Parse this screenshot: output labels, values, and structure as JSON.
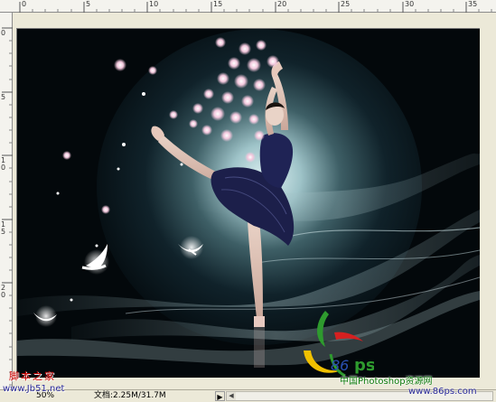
{
  "ruler_top_labels": [
    "0",
    "5",
    "10",
    "15",
    "20",
    "25",
    "30",
    "35"
  ],
  "ruler_left_labels": [
    "0",
    "5",
    "10",
    "15",
    "20"
  ],
  "status": {
    "zoom": "50%",
    "document": "文档:2.25M/31.7M",
    "menu_arrow": "▶"
  },
  "watermarks": {
    "site_cn": "脚本之家",
    "site_url": "www.Jb51.net",
    "logo_number": "86",
    "logo_ps": "ps",
    "brand_cn": "中国Photoshop资源网",
    "brand_url": "www.86ps.com"
  },
  "colors": {
    "background": "#000000",
    "glow": "#cfe6ea",
    "tutu": "#1c1f4a",
    "blossom": "#f2c6dc",
    "watermark_red": "#d00000",
    "watermark_green": "#0a7a0a"
  },
  "icons": [
    "dove-icon",
    "blossom-icon",
    "logo-icon"
  ]
}
